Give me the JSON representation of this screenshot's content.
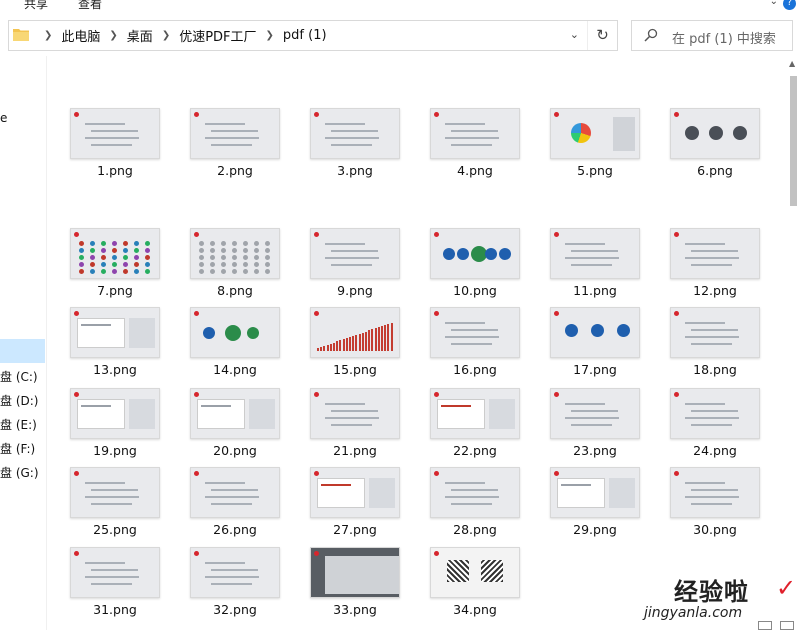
{
  "ribbon": {
    "tabs": [
      "共享",
      "查看"
    ]
  },
  "address": {
    "breadcrumbs": [
      "此电脑",
      "桌面",
      "优速PDF工厂",
      "pdf (1)"
    ]
  },
  "search": {
    "placeholder": "在 pdf (1) 中搜索"
  },
  "navpane": {
    "fragments": [
      "e",
      "盘 (C:)",
      "盘 (D:)",
      "盘 (E:)",
      "盘 (F:)",
      "盘 (G:)"
    ]
  },
  "files": [
    {
      "name": "1.png"
    },
    {
      "name": "2.png"
    },
    {
      "name": "3.png"
    },
    {
      "name": "4.png"
    },
    {
      "name": "5.png"
    },
    {
      "name": "6.png"
    },
    {
      "name": "7.png"
    },
    {
      "name": "8.png"
    },
    {
      "name": "9.png"
    },
    {
      "name": "10.png"
    },
    {
      "name": "11.png"
    },
    {
      "name": "12.png"
    },
    {
      "name": "13.png"
    },
    {
      "name": "14.png"
    },
    {
      "name": "15.png"
    },
    {
      "name": "16.png"
    },
    {
      "name": "17.png"
    },
    {
      "name": "18.png"
    },
    {
      "name": "19.png"
    },
    {
      "name": "20.png"
    },
    {
      "name": "21.png"
    },
    {
      "name": "22.png"
    },
    {
      "name": "23.png"
    },
    {
      "name": "24.png"
    },
    {
      "name": "25.png"
    },
    {
      "name": "26.png"
    },
    {
      "name": "27.png"
    },
    {
      "name": "28.png"
    },
    {
      "name": "29.png"
    },
    {
      "name": "30.png"
    },
    {
      "name": "31.png"
    },
    {
      "name": "32.png"
    },
    {
      "name": "33.png"
    },
    {
      "name": "34.png"
    }
  ],
  "watermark": {
    "text": "经验啦",
    "url": "jingyanla.com"
  },
  "colors": {
    "selection": "#cce8ff",
    "accent_red": "#d6262d",
    "thumb_bg": "#e9eaed"
  }
}
